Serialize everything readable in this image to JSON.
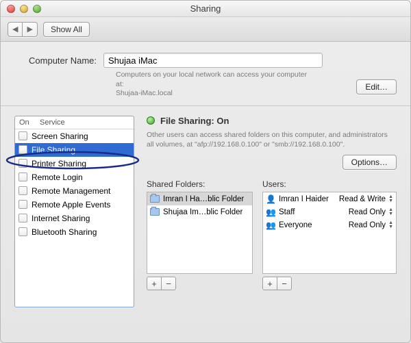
{
  "window": {
    "title": "Sharing"
  },
  "toolbar": {
    "back": "◀",
    "fwd": "▶",
    "showall": "Show All"
  },
  "computer": {
    "label": "Computer Name:",
    "value": "Shujaa iMac",
    "note1": "Computers on your local network can access your computer at:",
    "note2": "Shujaa-iMac.local",
    "edit": "Edit…"
  },
  "services": {
    "head_on": "On",
    "head_service": "Service",
    "items": [
      {
        "label": "Screen Sharing",
        "checked": false
      },
      {
        "label": "File Sharing",
        "checked": true
      },
      {
        "label": "Printer Sharing",
        "checked": false
      },
      {
        "label": "Remote Login",
        "checked": false
      },
      {
        "label": "Remote Management",
        "checked": false
      },
      {
        "label": "Remote Apple Events",
        "checked": false
      },
      {
        "label": "Internet Sharing",
        "checked": false
      },
      {
        "label": "Bluetooth Sharing",
        "checked": false
      }
    ]
  },
  "detail": {
    "status": "File Sharing: On",
    "desc": "Other users can access shared folders on this computer, and administrators all volumes, at \"afp://192.168.0.100\" or \"smb://192.168.0.100\".",
    "options": "Options…",
    "folders_title": "Shared Folders:",
    "users_title": "Users:",
    "folders": [
      {
        "name": "Imran I Ha…blic Folder"
      },
      {
        "name": "Shujaa Im…blic Folder"
      }
    ],
    "users": [
      {
        "name": "Imran I Haider",
        "perm": "Read & Write",
        "icon": "single"
      },
      {
        "name": "Staff",
        "perm": "Read Only",
        "icon": "group"
      },
      {
        "name": "Everyone",
        "perm": "Read Only",
        "icon": "group"
      }
    ],
    "plus": "+",
    "minus": "−"
  }
}
